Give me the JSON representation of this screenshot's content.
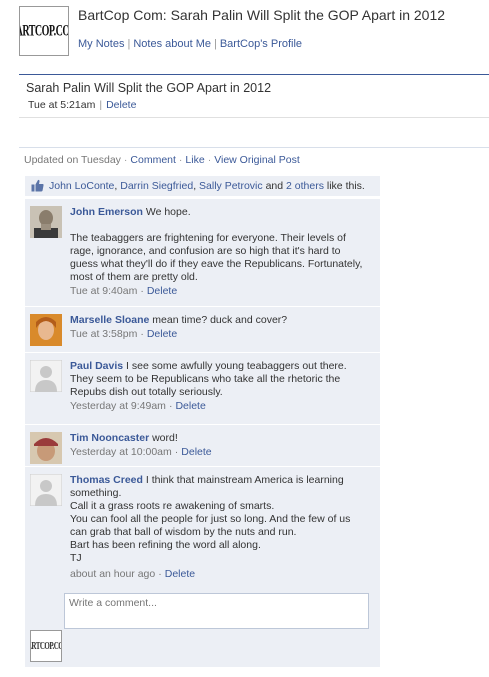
{
  "header": {
    "logo_text": "BARTCOP.COM",
    "title": "BartCop Com: Sarah Palin Will Split the GOP Apart in 2012",
    "links": [
      "My Notes",
      "Notes about Me",
      "BartCop's Profile"
    ],
    "separator": "|"
  },
  "post": {
    "title": "Sarah Palin Will Split the GOP Apart in 2012",
    "time": "Tue at 5:21am",
    "separator": "|",
    "delete_label": "Delete"
  },
  "updated": {
    "text": "Updated on Tuesday",
    "dot": "·",
    "comment_label": "Comment",
    "like_label": "Like",
    "original_label": "View Original Post"
  },
  "likes": {
    "names": [
      "John LoConte",
      "Darrin Siegfried",
      "Sally Petrovic"
    ],
    "comma": ",",
    "and_text": "and",
    "others_link": "2 others",
    "suffix": "like this."
  },
  "comments": [
    {
      "name": "John Emerson",
      "paragraphs": [
        "We hope.",
        "",
        "The teabaggers are frightening for everyone. Their levels of rage, ignorance, and confusion are so high that it's hard to guess what they'll do if they eave the Republicans. Fortunately, most of them are pretty old."
      ],
      "time": "Tue at 9:40am",
      "dot": "·",
      "delete_label": "Delete"
    },
    {
      "name": "Marselle Sloane",
      "paragraphs": [
        "mean time? duck and cover?"
      ],
      "time": "Tue at 3:58pm",
      "dot": "·",
      "delete_label": "Delete"
    },
    {
      "name": "Paul Davis",
      "paragraphs": [
        "I see some awfully young teabaggers out there. They seem to be Republicans who take all the rhetoric the Repubs dish out totally seriously."
      ],
      "time": "Yesterday at 9:49am",
      "dot": "·",
      "delete_label": "Delete"
    },
    {
      "name": "Tim Nooncaster",
      "paragraphs": [
        "word!"
      ],
      "time": "Yesterday at 10:00am",
      "dot": "·",
      "delete_label": "Delete"
    },
    {
      "name": "Thomas Creed",
      "paragraphs": [
        "I think that mainstream America is learning something.",
        "Call it a grass roots re awakening of smarts.",
        "You can fool all the people for just so long. And the few of us can grab that ball of wisdom by the nuts and run.",
        "Bart has been refining the word all along.",
        "TJ"
      ],
      "time": "about an hour ago",
      "dot": "·",
      "delete_label": "Delete"
    }
  ],
  "compose": {
    "placeholder": "Write a comment...",
    "logo_text": "BARTCOP.COM"
  },
  "colors": {
    "link": "#3b5998",
    "comment_bg": "#eceff5",
    "divider": "#3b5998"
  }
}
